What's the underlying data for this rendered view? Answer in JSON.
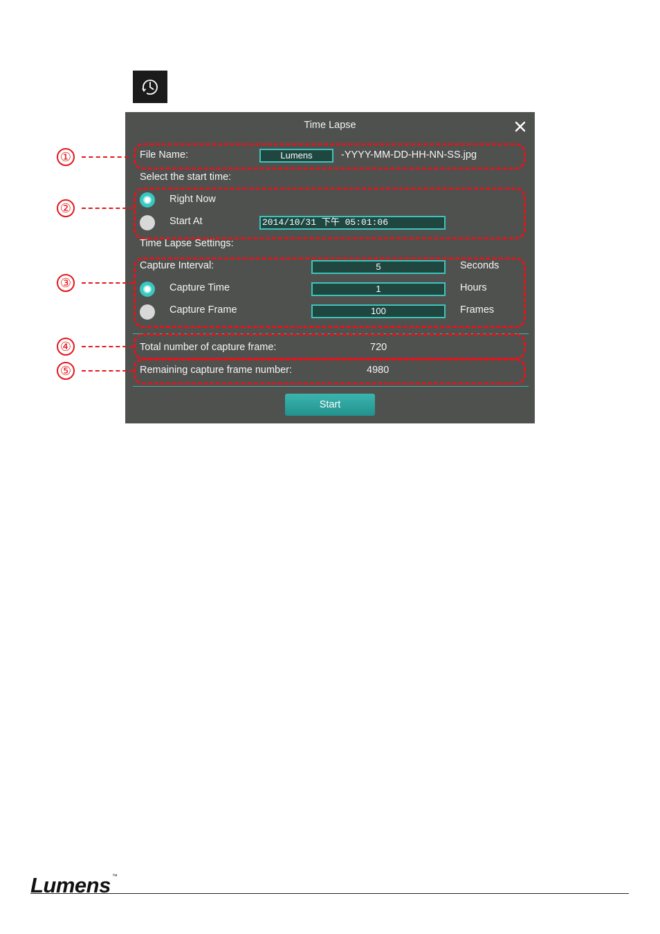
{
  "icon": {
    "name": "clock-icon"
  },
  "dialog": {
    "title": "Time Lapse",
    "close_label": "×",
    "file_name": {
      "label": "File Name:",
      "value": "Lumens",
      "suffix": "-YYYY-MM-DD-HH-NN-SS.jpg"
    },
    "start_time": {
      "heading": "Select the start time:",
      "right_now_label": "Right Now",
      "right_now_selected": true,
      "start_at_label": "Start At",
      "start_at_selected": false,
      "start_at_value": "2014/10/31 下午 05:01:06"
    },
    "settings": {
      "heading": "Time Lapse Settings:",
      "interval_label": "Capture Interval:",
      "interval_value": "5",
      "interval_unit": "Seconds",
      "capture_time_label": "Capture Time",
      "capture_time_selected": true,
      "capture_time_value": "1",
      "capture_time_unit": "Hours",
      "capture_frame_label": "Capture Frame",
      "capture_frame_selected": false,
      "capture_frame_value": "100",
      "capture_frame_unit": "Frames"
    },
    "total_frames": {
      "label": "Total number of capture frame:",
      "value": "720"
    },
    "remaining_frames": {
      "label": "Remaining capture frame number:",
      "value": "4980"
    },
    "start_label": "Start"
  },
  "callouts": [
    "①",
    "②",
    "③",
    "④",
    "⑤"
  ],
  "colors": {
    "dialog_bg": "#4f514f",
    "accent": "#3ec4bd",
    "callout_red": "#e3151b"
  },
  "footer": {
    "brand": "Lumens",
    "trademark": "™"
  }
}
